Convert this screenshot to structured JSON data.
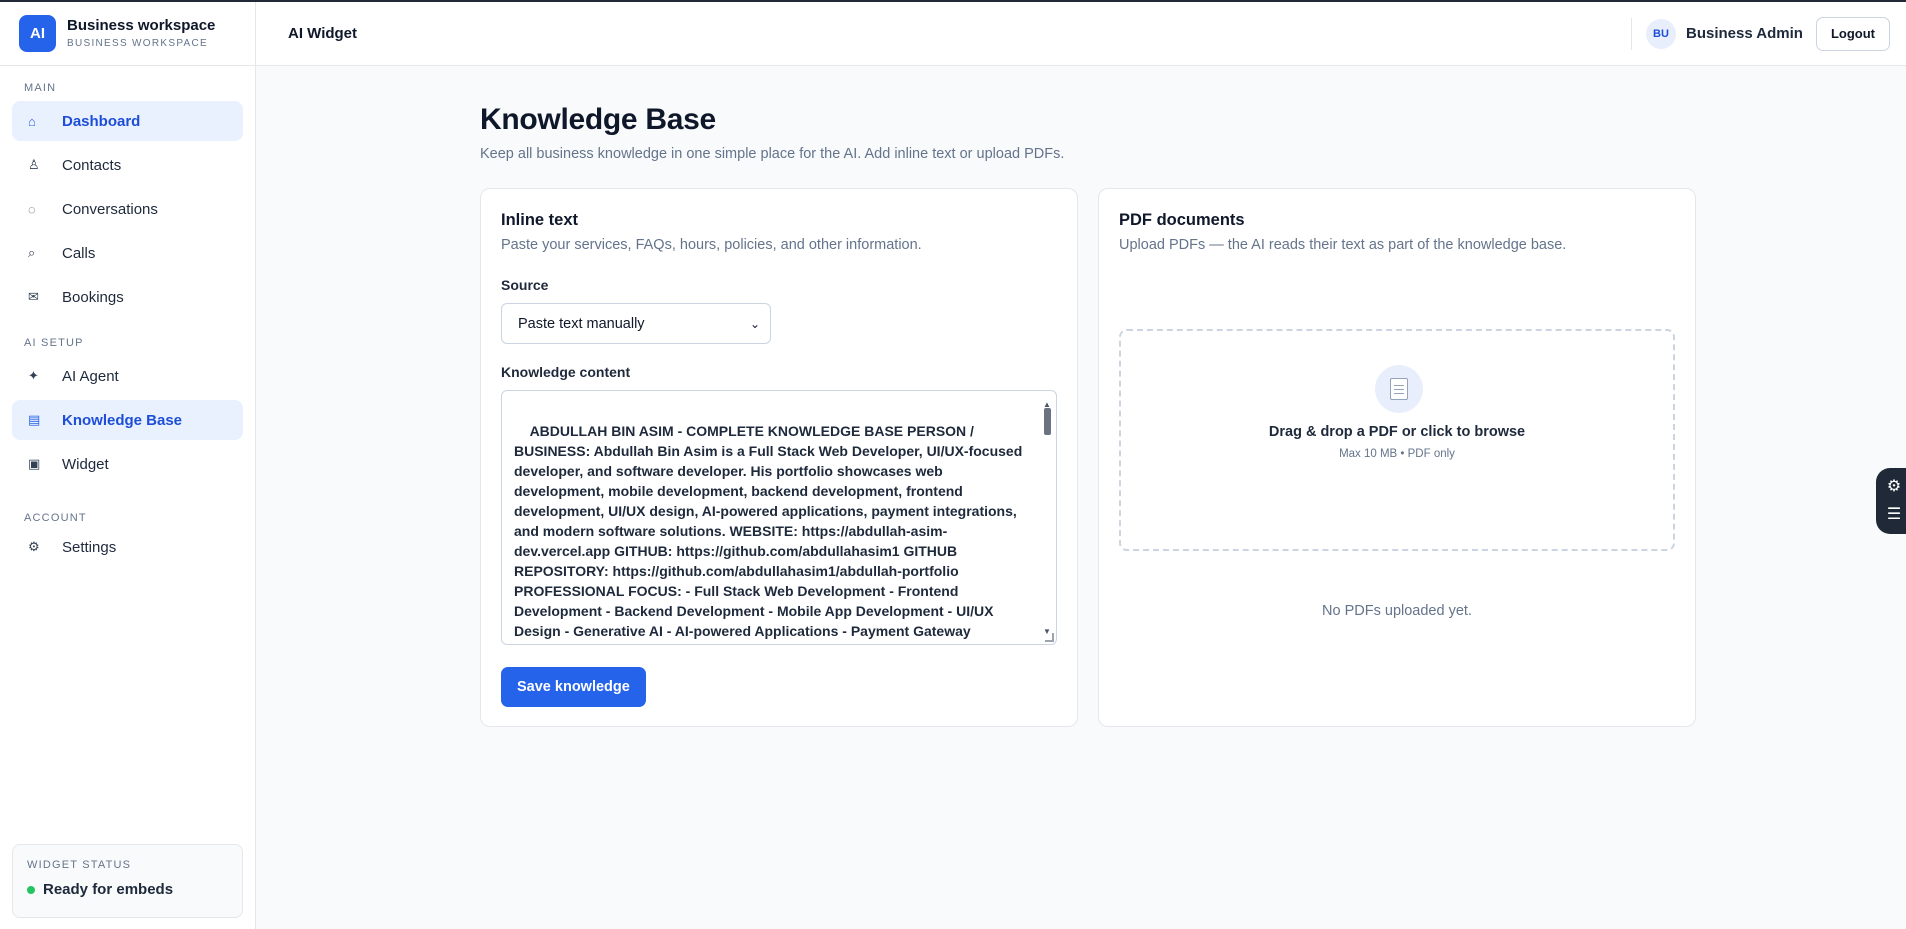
{
  "brand": {
    "logo_text": "AI",
    "title": "Business workspace",
    "subtitle": "BUSINESS WORKSPACE"
  },
  "sidebar": {
    "sections": [
      {
        "label": "MAIN",
        "items": [
          {
            "label": "Dashboard",
            "icon": "home-icon",
            "glyph": "⌂",
            "active": true
          },
          {
            "label": "Contacts",
            "icon": "user-icon",
            "glyph": "♙",
            "active": false
          },
          {
            "label": "Conversations",
            "icon": "chat-icon",
            "glyph": "◌",
            "active": false
          },
          {
            "label": "Calls",
            "icon": "phone-icon",
            "glyph": "⌕",
            "active": false
          },
          {
            "label": "Bookings",
            "icon": "mail-icon",
            "glyph": "✉",
            "active": false
          }
        ]
      },
      {
        "label": "AI SETUP",
        "items": [
          {
            "label": "AI Agent",
            "icon": "sparkle-icon",
            "glyph": "✦",
            "active": false
          },
          {
            "label": "Knowledge Base",
            "icon": "book-icon",
            "glyph": "▤",
            "active": true
          },
          {
            "label": "Widget",
            "icon": "widget-icon",
            "glyph": "▣",
            "active": false
          }
        ]
      },
      {
        "label": "ACCOUNT",
        "items": [
          {
            "label": "Settings",
            "icon": "gear-icon",
            "glyph": "⚙",
            "active": false
          }
        ]
      }
    ],
    "widget_status": {
      "title": "WIDGET STATUS",
      "status_text": "Ready for embeds",
      "status_color": "#22c55e"
    }
  },
  "topbar": {
    "title": "AI Widget",
    "avatar_initials": "BU",
    "user_name": "Business Admin",
    "logout_label": "Logout"
  },
  "page": {
    "title": "Knowledge Base",
    "subtitle": "Keep all business knowledge in one simple place for the AI. Add inline text or upload PDFs."
  },
  "inline_card": {
    "title": "Inline text",
    "subtitle": "Paste your services, FAQs, hours, policies, and other information.",
    "source_label": "Source",
    "source_value": "Paste text manually",
    "content_label": "Knowledge content",
    "content_value": "ABDULLAH BIN ASIM - COMPLETE KNOWLEDGE BASE PERSON / BUSINESS: Abdullah Bin Asim is a Full Stack Web Developer, UI/UX-focused developer, and software developer. His portfolio showcases web development, mobile development, backend development, frontend development, UI/UX design, AI-powered applications, payment integrations, and modern software solutions. WEBSITE: https://abdullah-asim-dev.vercel.app GITHUB: https://github.com/abdullahasim1 GITHUB REPOSITORY: https://github.com/abdullahasim1/abdullah-portfolio PROFESSIONAL FOCUS: - Full Stack Web Development - Frontend Development - Backend Development - Mobile App Development - UI/UX Design - Generative AI - AI-powered Applications - Payment Gateway Integration - Cloud Integration - API Development - Database Design SERVICES: WEB APP DEVELOPMENT: - Custom web applications",
    "save_label": "Save knowledge"
  },
  "pdf_card": {
    "title": "PDF documents",
    "subtitle": "Upload PDFs — the AI reads their text as part of the knowledge base.",
    "dropzone_title": "Drag & drop a PDF or click to browse",
    "dropzone_hint": "Max 10 MB • PDF only",
    "empty_text": "No PDFs uploaded yet."
  },
  "colors": {
    "accent": "#2563eb",
    "active_bg": "#eaf1fe",
    "status_ok": "#22c55e"
  }
}
